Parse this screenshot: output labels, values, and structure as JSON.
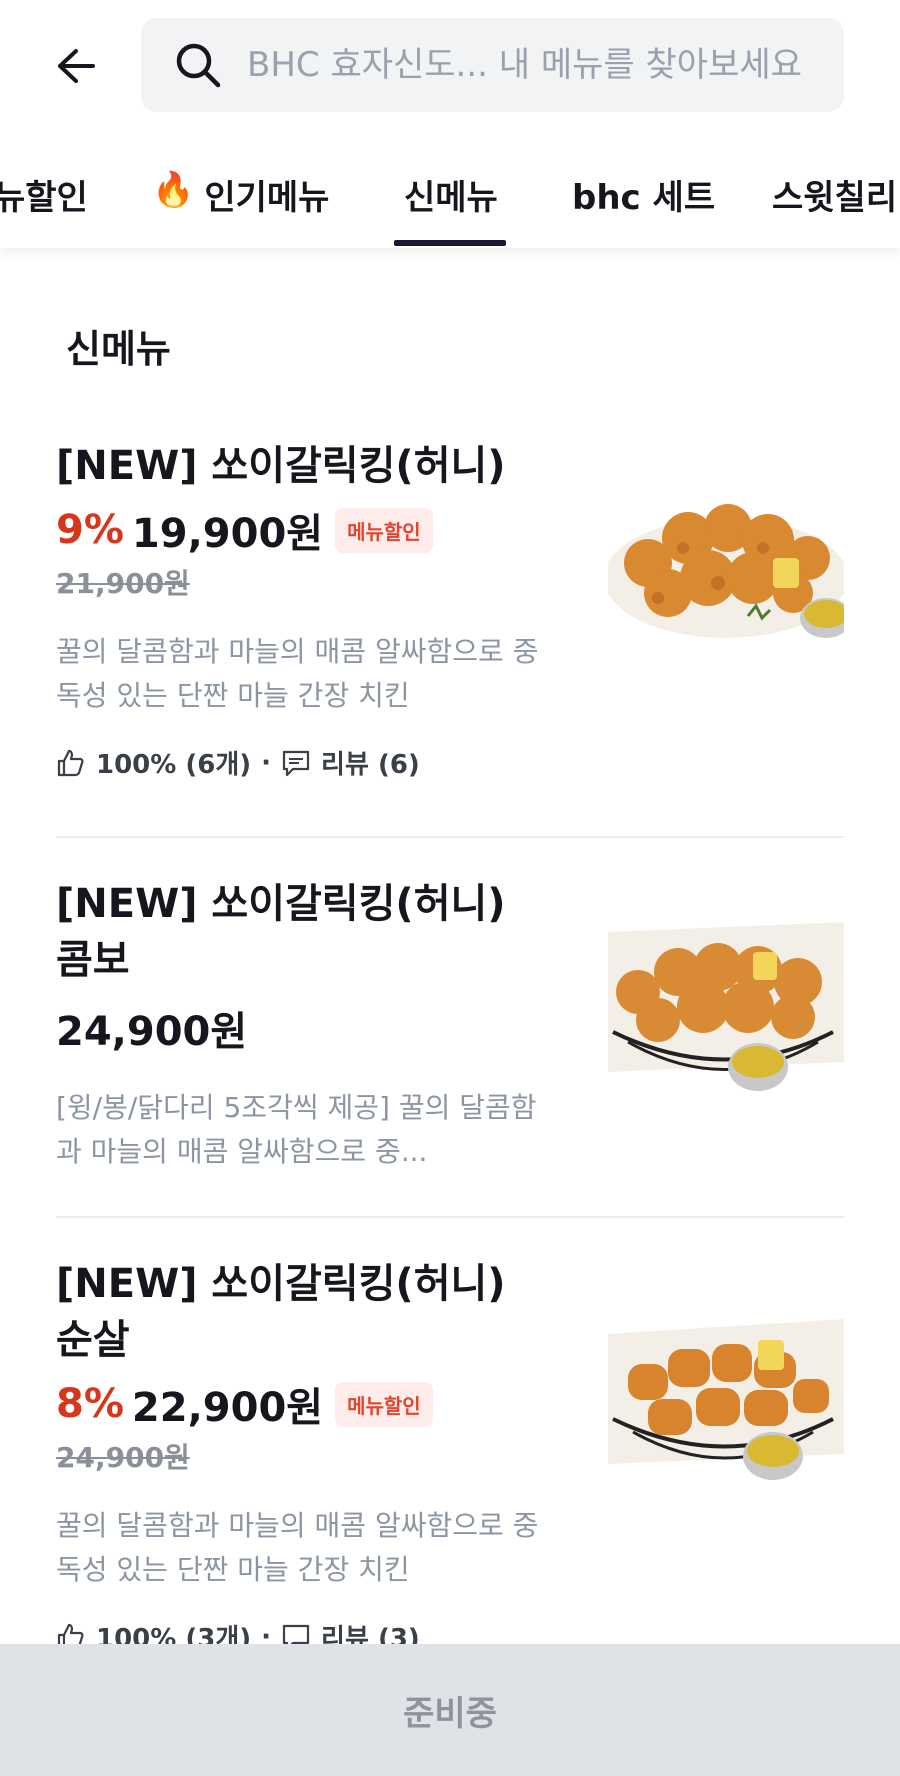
{
  "search": {
    "placeholder": "BHC 효자신도... 내 메뉴를 찾아보세요"
  },
  "tabs": [
    {
      "label": "뉴할인",
      "emoji": ""
    },
    {
      "label": "인기메뉴",
      "emoji": "🔥"
    },
    {
      "label": "신메뉴",
      "emoji": "",
      "active": true
    },
    {
      "label": "bhc 세트",
      "emoji": ""
    },
    {
      "label": "스윗칠리",
      "emoji": ""
    }
  ],
  "section": {
    "title": "신메뉴"
  },
  "items": [
    {
      "name": "[NEW] 쏘이갈릭킹(허니)",
      "discount": "9%",
      "price": "19,900원",
      "badge": "메뉴할인",
      "original_price": "21,900원",
      "description": "꿀의 달콤함과 마늘의 매콤 알싸함으로 중독성 있는 단짠 마늘 간장 치킨",
      "rating": "100% (6개)",
      "reviews": "리뷰 (6)"
    },
    {
      "name": "[NEW] 쏘이갈릭킹(허니) 콤보",
      "price": "24,900원",
      "description": "[윙/봉/닭다리 5조각씩 제공] 꿀의 달콤함과 마늘의 매콤 알싸함으로 중..."
    },
    {
      "name": "[NEW] 쏘이갈릭킹(허니) 순살",
      "discount": "8%",
      "price": "22,900원",
      "badge": "메뉴할인",
      "original_price": "24,900원",
      "description": "꿀의 달콤함과 마늘의 매콤 알싸함으로 중독성 있는 단짠 마늘 간장 치킨",
      "rating": "100% (3개)",
      "reviews": "리뷰 (3)"
    }
  ],
  "bottom_bar": {
    "label": "준비중"
  },
  "colors": {
    "discount": "#d6361c",
    "badge_bg": "#fdecea",
    "tab_indicator": "#1c1432",
    "bottom_bar": "#dfe2e6"
  }
}
